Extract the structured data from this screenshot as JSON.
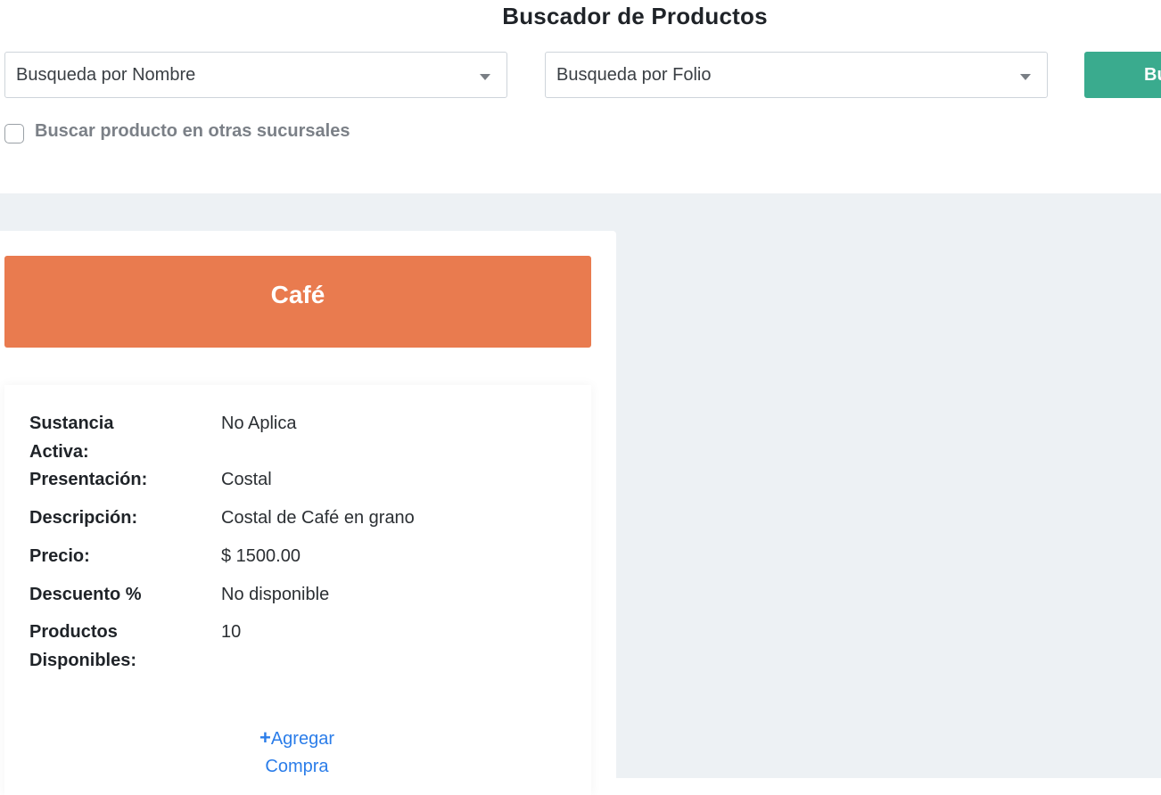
{
  "page": {
    "title": "Buscador de Productos"
  },
  "filters": {
    "name_select": "Busqueda por Nombre",
    "folio_select": "Busqueda por Folio",
    "search_button": "Bu",
    "other_branches_label": "Buscar producto en otras sucursales",
    "other_branches_checked": false
  },
  "colors": {
    "accent_green": "#3aab8e",
    "banner_orange": "#e97b4f",
    "link_blue": "#2b7de9",
    "content_bg": "#edf1f4"
  },
  "product": {
    "name": "Café",
    "fields": [
      {
        "label": "Sustancia Activa:",
        "value": "No Aplica"
      },
      {
        "label": "Presentación:",
        "value": "Costal"
      },
      {
        "label": "Descripción:",
        "value": "Costal de Café en grano"
      },
      {
        "label": "Precio:",
        "value": "$ 1500.00"
      },
      {
        "label": "Descuento %",
        "value": "No disponible"
      },
      {
        "label": "Productos Disponibles:",
        "value": "10"
      }
    ],
    "add_icon": "plus-icon",
    "add_label": "Agregar Compra"
  }
}
